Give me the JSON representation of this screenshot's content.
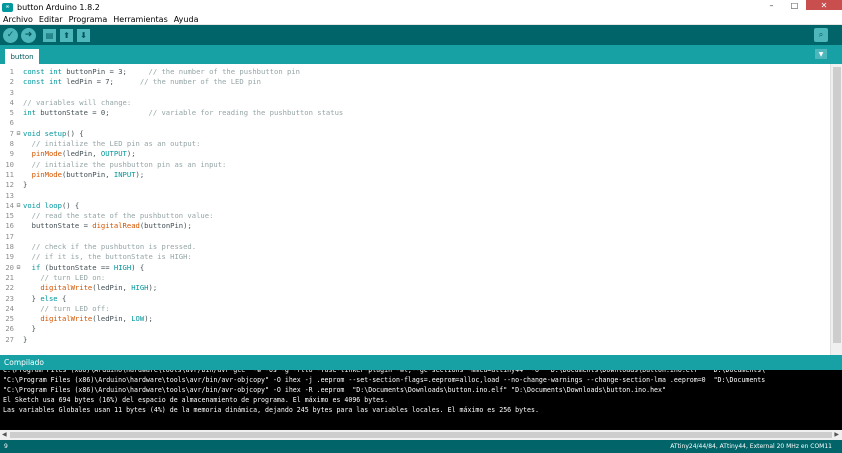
{
  "window": {
    "title": "button Arduino 1.8.2",
    "logo_text": "∞",
    "minimize": "–",
    "maximize": "□",
    "close": "✕"
  },
  "menu": [
    "Archivo",
    "Editar",
    "Programa",
    "Herramientas",
    "Ayuda"
  ],
  "toolbar": {
    "verify_icon": "check-icon",
    "upload_icon": "arrow-right-icon",
    "new_icon": "file-icon",
    "open_icon": "arrow-up-icon",
    "save_icon": "arrow-down-icon",
    "serial_icon": "magnifier-icon",
    "glyph_verify": "✓",
    "glyph_upload": "➜",
    "glyph_new": "▤",
    "glyph_open": "⬆",
    "glyph_save": "⬇",
    "glyph_serial": "⌕"
  },
  "tabs": [
    {
      "label": "button"
    }
  ],
  "tab_menu_glyph": "▼",
  "code_lines": [
    {
      "n": "1",
      "fold": "",
      "t": [
        [
          "kw",
          "const int"
        ],
        [
          "txt",
          " buttonPin = 3;     "
        ],
        [
          "cm",
          "// the number of the pushbutton pin"
        ]
      ]
    },
    {
      "n": "2",
      "fold": "",
      "t": [
        [
          "kw",
          "const int"
        ],
        [
          "txt",
          " ledPin = 7;      "
        ],
        [
          "cm",
          "// the number of the LED pin"
        ]
      ]
    },
    {
      "n": "3",
      "fold": "",
      "t": []
    },
    {
      "n": "4",
      "fold": "",
      "t": [
        [
          "cm",
          "// variables will change:"
        ]
      ]
    },
    {
      "n": "5",
      "fold": "",
      "t": [
        [
          "kw",
          "int"
        ],
        [
          "txt",
          " buttonState = 0;         "
        ],
        [
          "cm",
          "// variable for reading the pushbutton status"
        ]
      ]
    },
    {
      "n": "6",
      "fold": "",
      "t": []
    },
    {
      "n": "7",
      "fold": "⊟",
      "t": [
        [
          "kw",
          "void"
        ],
        [
          "txt",
          " "
        ],
        [
          "kw",
          "setup"
        ],
        [
          "txt",
          "() {"
        ]
      ]
    },
    {
      "n": "8",
      "fold": "",
      "t": [
        [
          "txt",
          "  "
        ],
        [
          "cm",
          "// initialize the LED pin as an output:"
        ]
      ]
    },
    {
      "n": "9",
      "fold": "",
      "t": [
        [
          "txt",
          "  "
        ],
        [
          "fn",
          "pinMode"
        ],
        [
          "txt",
          "(ledPin, "
        ],
        [
          "kw",
          "OUTPUT"
        ],
        [
          "txt",
          ");"
        ]
      ]
    },
    {
      "n": "10",
      "fold": "",
      "t": [
        [
          "txt",
          "  "
        ],
        [
          "cm",
          "// initialize the pushbutton pin as an input:"
        ]
      ]
    },
    {
      "n": "11",
      "fold": "",
      "t": [
        [
          "txt",
          "  "
        ],
        [
          "fn",
          "pinMode"
        ],
        [
          "txt",
          "(buttonPin, "
        ],
        [
          "kw",
          "INPUT"
        ],
        [
          "txt",
          ");"
        ]
      ]
    },
    {
      "n": "12",
      "fold": "",
      "t": [
        [
          "txt",
          "}"
        ]
      ]
    },
    {
      "n": "13",
      "fold": "",
      "t": []
    },
    {
      "n": "14",
      "fold": "⊟",
      "t": [
        [
          "kw",
          "void"
        ],
        [
          "txt",
          " "
        ],
        [
          "kw",
          "loop"
        ],
        [
          "txt",
          "() {"
        ]
      ]
    },
    {
      "n": "15",
      "fold": "",
      "t": [
        [
          "txt",
          "  "
        ],
        [
          "cm",
          "// read the state of the pushbutton value:"
        ]
      ]
    },
    {
      "n": "16",
      "fold": "",
      "t": [
        [
          "txt",
          "  buttonState = "
        ],
        [
          "fn",
          "digitalRead"
        ],
        [
          "txt",
          "(buttonPin);"
        ]
      ]
    },
    {
      "n": "17",
      "fold": "",
      "t": []
    },
    {
      "n": "18",
      "fold": "",
      "t": [
        [
          "txt",
          "  "
        ],
        [
          "cm",
          "// check if the pushbutton is pressed."
        ]
      ]
    },
    {
      "n": "19",
      "fold": "",
      "t": [
        [
          "txt",
          "  "
        ],
        [
          "cm",
          "// if it is, the buttonState is HIGH:"
        ]
      ]
    },
    {
      "n": "20",
      "fold": "⊟",
      "t": [
        [
          "txt",
          "  "
        ],
        [
          "kw",
          "if"
        ],
        [
          "txt",
          " (buttonState == "
        ],
        [
          "kw",
          "HIGH"
        ],
        [
          "txt",
          ") {"
        ]
      ]
    },
    {
      "n": "21",
      "fold": "",
      "t": [
        [
          "txt",
          "    "
        ],
        [
          "cm",
          "// turn LED on:"
        ]
      ]
    },
    {
      "n": "22",
      "fold": "",
      "t": [
        [
          "txt",
          "    "
        ],
        [
          "fn",
          "digitalWrite"
        ],
        [
          "txt",
          "(ledPin, "
        ],
        [
          "kw",
          "HIGH"
        ],
        [
          "txt",
          ");"
        ]
      ]
    },
    {
      "n": "23",
      "fold": "",
      "t": [
        [
          "txt",
          "  } "
        ],
        [
          "kw",
          "else"
        ],
        [
          "txt",
          " {"
        ]
      ]
    },
    {
      "n": "24",
      "fold": "",
      "t": [
        [
          "txt",
          "    "
        ],
        [
          "cm",
          "// turn LED off:"
        ]
      ]
    },
    {
      "n": "25",
      "fold": "",
      "t": [
        [
          "txt",
          "    "
        ],
        [
          "fn",
          "digitalWrite"
        ],
        [
          "txt",
          "(ledPin, "
        ],
        [
          "kw",
          "LOW"
        ],
        [
          "txt",
          ");"
        ]
      ]
    },
    {
      "n": "26",
      "fold": "",
      "t": [
        [
          "txt",
          "  }"
        ]
      ]
    },
    {
      "n": "27",
      "fold": "",
      "t": [
        [
          "txt",
          "}"
        ]
      ]
    }
  ],
  "status": "Compilado",
  "console_lines": [
    "C:\\Program Files (x86)\\Arduino\\hardware\\tools\\avr/bin/avr-gcc\" -w -Os -g -flto -fuse-linker-plugin -Wl,--gc-sections -mmcu=attiny44  -o  \"D:\\Documents\\Downloads\\button.ino.elf\"  \"D:\\Documents\\",
    "\"C:\\Program Files (x86)\\Arduino\\hardware\\tools\\avr/bin/avr-objcopy\" -O ihex -j .eeprom --set-section-flags=.eeprom=alloc,load --no-change-warnings --change-section-lma .eeprom=0  \"D:\\Documents",
    "\"C:\\Program Files (x86)\\Arduino\\hardware\\tools\\avr/bin/avr-objcopy\" -O ihex -R .eeprom  \"D:\\Documents\\Downloads\\button.ino.elf\" \"D:\\Documents\\Downloads\\button.ino.hex\"",
    "El Sketch usa 694 bytes (16%) del espacio de almacenamiento de programa. El máximo es 4096 bytes.",
    "Las variables Globales usan 11 bytes (4%) de la memoria dinámica, dejando 245 bytes para las variables locales. El máximo es 256 bytes."
  ],
  "hscroll": {
    "left": "◀",
    "right": "▶"
  },
  "footer": {
    "line_number": "9",
    "board": "ATtiny24/44/84, ATtiny44, External 20 MHz en COM11"
  },
  "colors": {
    "toolbar": "#006468",
    "tabbar": "#17a1a5",
    "keyword": "#00979c",
    "function": "#d35400",
    "comment": "#95a5a6"
  }
}
